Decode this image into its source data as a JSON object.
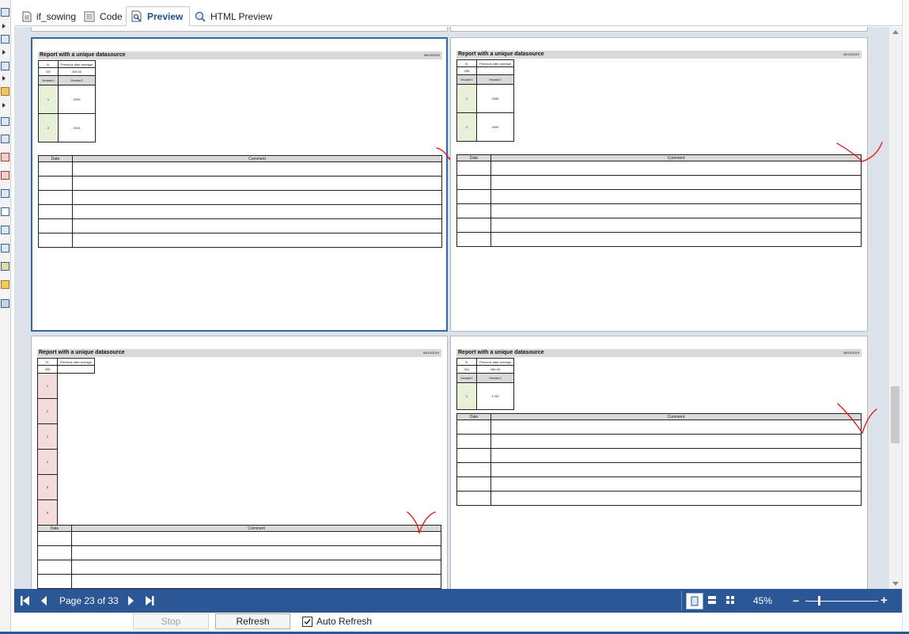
{
  "tabs": [
    {
      "label": "if_sowing",
      "icon": "document-icon"
    },
    {
      "label": "Code",
      "icon": "code-icon"
    },
    {
      "label": "Preview",
      "icon": "magnifier-page-icon",
      "active": true
    },
    {
      "label": "HTML Preview",
      "icon": "html-preview-icon"
    }
  ],
  "report": {
    "title": "Report with a unique datasource",
    "date": "08/10/2019",
    "col_n": "N.",
    "col_prev": "Previous date average",
    "header1": "Header1",
    "header2": "Header2",
    "date_header": "Date",
    "comment_header": "Comment",
    "pages": [
      {
        "n": "337",
        "prev": "345.00",
        "rows": [
          {
            "h1": "1",
            "h2": "2039"
          },
          {
            "h1": "2",
            "h2": "2041"
          }
        ]
      },
      {
        "n": "338",
        "prev": "",
        "rows": [
          {
            "h1": "1",
            "h2": "2089"
          },
          {
            "h1": "2",
            "h2": "2090"
          }
        ]
      },
      {
        "n": "339",
        "prev": "",
        "rows": [
          {
            "h1": "1"
          },
          {
            "h1": "2"
          },
          {
            "h1": "3"
          },
          {
            "h1": "4"
          },
          {
            "h1": "5"
          },
          {
            "h1": "6"
          }
        ]
      },
      {
        "n": "341",
        "prev": "456.00",
        "rows": [
          {
            "h1": "1",
            "h2": "1700"
          }
        ]
      }
    ]
  },
  "navigation": {
    "page_label": "Page 23 of 33",
    "zoom": "45%"
  },
  "controls": {
    "stop_label": "Stop",
    "refresh_label": "Refresh",
    "auto_refresh_label": "Auto Refresh",
    "auto_refresh_checked": true
  },
  "colors": {
    "nav_bar": "#2b5797",
    "active_tab_text": "#1e4f91",
    "selected_page_border": "#3566a6",
    "check_mark": "#e01010"
  }
}
